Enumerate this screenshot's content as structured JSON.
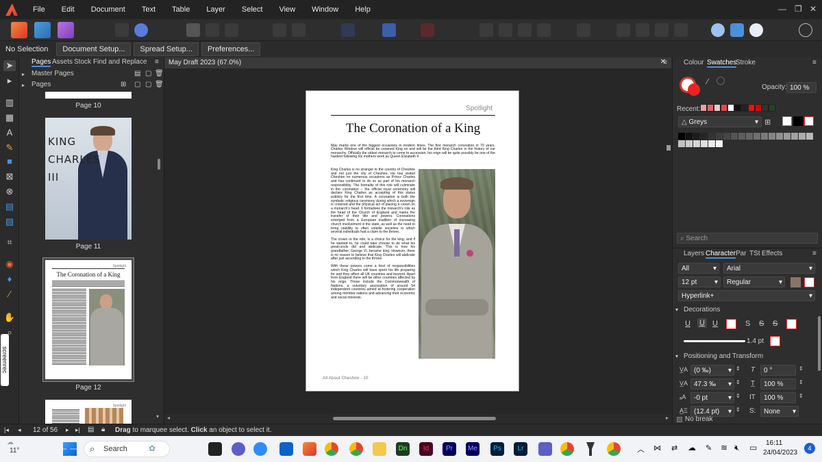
{
  "menubar": {
    "items": [
      "File",
      "Edit",
      "Document",
      "Text",
      "Table",
      "Layer",
      "Select",
      "View",
      "Window",
      "Help"
    ],
    "window_controls": {
      "minimize": "—",
      "restore": "❐",
      "close": "✕"
    }
  },
  "context": {
    "selection": "No Selection",
    "buttons": [
      "Document Setup...",
      "Spread Setup...",
      "Preferences..."
    ]
  },
  "pages_panel": {
    "tabs": [
      "Pages",
      "Assets",
      "Stock",
      "Find and Replace"
    ],
    "master_pages": "Master Pages",
    "pages": "Pages",
    "thumbs": [
      {
        "label": "Page 10"
      },
      {
        "label": "Page 11",
        "title_lines": [
          "KING",
          "CHARLES",
          "III"
        ]
      },
      {
        "label": "Page 12",
        "title": "The Coronation of a King",
        "kicker": "Spotlight"
      },
      {
        "label": "",
        "kicker": "Spotlight"
      }
    ]
  },
  "document": {
    "tab_title": "May Draft 2023 (67.0%)",
    "kicker": "Spotlight",
    "title": "The Coronation of a King",
    "intro": "May marks one of the biggest occasions in modern times. The first monarch coronation in 70 years. Charles Windsor will official be crowned King on and will be the third King Charles in the history of our monarchy. Officially the oldest monarch to come to accession, his reign will be quite possibly be one of the hardest following his mothers work as Queen Elizabeth II.",
    "col1": "King Charles is no stranger to the country of Cheshire and not just the city of Cheshire. He has visited Cheshire on numerous occasions as Prince Charles and has continued to do so as part of his monarch responsibility. The formality of this role will culminate in the coronation – the official royal ceremony will declare King Charles as accepting of this status publicly for the first time. A coronation is both the symbolic religious ceremony during which a sovereign is crowned and the physical act of placing a crown on a monarch's head. It formalises the monarch's role as the head of the Church of England and marks the transfer of their title and powers. Coronations emerged from a European tradition of increasing church involvement in the state, as well as the need to bring stability to often volatile societies in which several individuals had a claim to the throne.",
    "col2": "The crown or the role, is a choice for the king, and if he wanted to, he could take choose to do what his great-uncle did and abdicate. This is how his grandfather, George VI, became king. However, there is no reason to believe that King Charles will abdicate after just ascending to the throne.",
    "col3": "With these powers come a host of responsibilities which King Charles will have spent his life preparing for and they affect all UK countries and beyond. Apart from England there will be other countries affected by his reign. Those include the Commonwealth of Nations, a voluntary association of around 54 independent countries aimed at fostering cooperation among member nations and advancing their economic and social interests.",
    "footer": "All About Cheshire - 10"
  },
  "right_panel": {
    "tabs_top": [
      "Colour",
      "Swatches",
      "Stroke"
    ],
    "opacity_label": "Opacity:",
    "opacity_value": "100 %",
    "recent_label": "Recent:",
    "palette": "Greys",
    "search_placeholder": "Search",
    "tabs_mid": [
      "Layers",
      "Character",
      "Par",
      "TSt",
      "Effects"
    ],
    "char": {
      "scope": "All",
      "font": "Arial",
      "size": "12 pt",
      "weight": "Regular",
      "style": "Hyperlink+"
    },
    "decorations_label": "Decorations",
    "stroke_width": "1.4 pt",
    "positioning_label": "Positioning and Transform",
    "pos": {
      "kerning": "(0 ‰)",
      "skew": "0 °",
      "tracking": "47.3 ‰",
      "vscale": "100 %",
      "baseline": "-0 pt",
      "hscale": "100 %",
      "leading": "(12.4 pt)",
      "sub": "None"
    },
    "no_break": "No break"
  },
  "status": {
    "page_of": "12 of 56",
    "hint_bold1": "Drag",
    "hint1": " to marquee select. ",
    "hint_bold2": "Click",
    "hint2": " an object to select it."
  },
  "taskbar": {
    "weather": "11°",
    "search": "Search",
    "time": "16:11",
    "date": "24/04/2023",
    "badge": "4",
    "app_labels": [
      "Dn",
      "Id",
      "Pr",
      "Me",
      "Ps",
      "Lr"
    ]
  },
  "colors": {
    "accent": "#4a90d9",
    "recent_swatches": [
      "#e8a0a0",
      "#d66",
      "#f4c8c8",
      "#e44",
      "#fff",
      "#111",
      "#222",
      "#e11",
      "#d00",
      "#333",
      "#224422"
    ]
  }
}
